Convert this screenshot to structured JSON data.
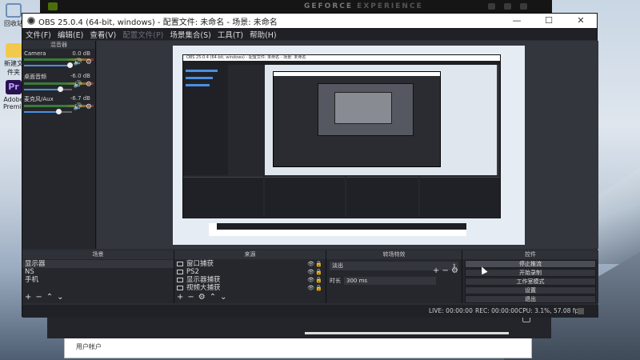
{
  "desktop": {
    "icons": [
      {
        "label": "回收站",
        "glyph": "recycle-bin-icon"
      },
      {
        "label": "新建文件夹",
        "glyph": "folder-icon"
      },
      {
        "label": "Adobe Premiere",
        "glyph": "premiere-icon"
      }
    ],
    "background_window": {
      "label": "用户帐户"
    }
  },
  "overlay": {
    "title_a": "GEFORCE",
    "title_b": "EXPERIENCE"
  },
  "obs": {
    "title": "OBS 25.0.4 (64-bit, windows) - 配置文件: 未命名 - 场景: 未命名",
    "menu": [
      {
        "label": "文件(F)",
        "enabled": true
      },
      {
        "label": "编辑(E)",
        "enabled": true
      },
      {
        "label": "查看(V)",
        "enabled": true
      },
      {
        "label": "配置文件(P)",
        "enabled": false
      },
      {
        "label": "场景集合(S)",
        "enabled": true
      },
      {
        "label": "工具(T)",
        "enabled": true
      },
      {
        "label": "帮助(H)",
        "enabled": true
      }
    ],
    "mixer": {
      "title": "混音器",
      "channels": [
        {
          "name": "Camera",
          "db": "0.0 dB",
          "level": 0.92
        },
        {
          "name": "桌面音频",
          "db": "-6.0 dB",
          "level": 0.72
        },
        {
          "name": "麦克风/Aux",
          "db": "-6.7 dB",
          "level": 0.7
        }
      ]
    },
    "nested": {
      "title": "OBS 25.0.4 (64-bit, windows) - 配置文件: 未命名 - 场景: 未命名"
    },
    "scenes": {
      "title": "场景",
      "items": [
        "显示器",
        "NS",
        "手机"
      ],
      "selected": 0
    },
    "sources": {
      "title": "来源",
      "items": [
        "窗口捕获",
        "PS2",
        "显示器捕获",
        "视频大捕获"
      ]
    },
    "transitions": {
      "title": "转场特效",
      "selected": "淡出",
      "duration_label": "时长",
      "duration_value": "300 ms"
    },
    "controls": {
      "title": "控件",
      "buttons": [
        "停止推流",
        "开始录制",
        "工作室模式",
        "设置",
        "退出"
      ]
    },
    "status": {
      "live": "LIVE: 00:00:00",
      "rec": "REC: 00:00:00",
      "cpu_fps": "CPU: 3.1%, 57.08 fps"
    }
  }
}
